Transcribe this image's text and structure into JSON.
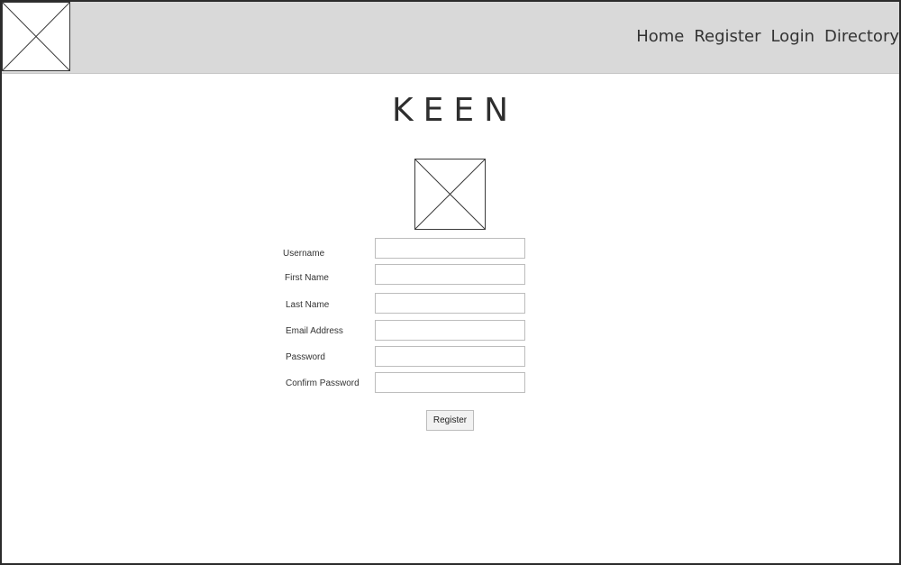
{
  "header": {
    "logo_icon": "image-placeholder-icon",
    "nav": [
      {
        "label": "Home"
      },
      {
        "label": "Register"
      },
      {
        "label": "Login"
      },
      {
        "label": "Directory"
      }
    ]
  },
  "main": {
    "brand_title": "KEEN",
    "image_icon": "image-placeholder-icon",
    "form": {
      "fields": [
        {
          "label": "Username",
          "value": "",
          "placeholder": ""
        },
        {
          "label": "First Name",
          "value": "",
          "placeholder": ""
        },
        {
          "label": "Last Name",
          "value": "",
          "placeholder": ""
        },
        {
          "label": "Email Address",
          "value": "",
          "placeholder": ""
        },
        {
          "label": "Password",
          "value": "",
          "placeholder": ""
        },
        {
          "label": "Confirm Password",
          "value": "",
          "placeholder": ""
        }
      ],
      "submit_label": "Register"
    }
  },
  "colors": {
    "header_background": "#d9d9d9",
    "text": "#333333",
    "input_border": "#bdbdbd"
  }
}
